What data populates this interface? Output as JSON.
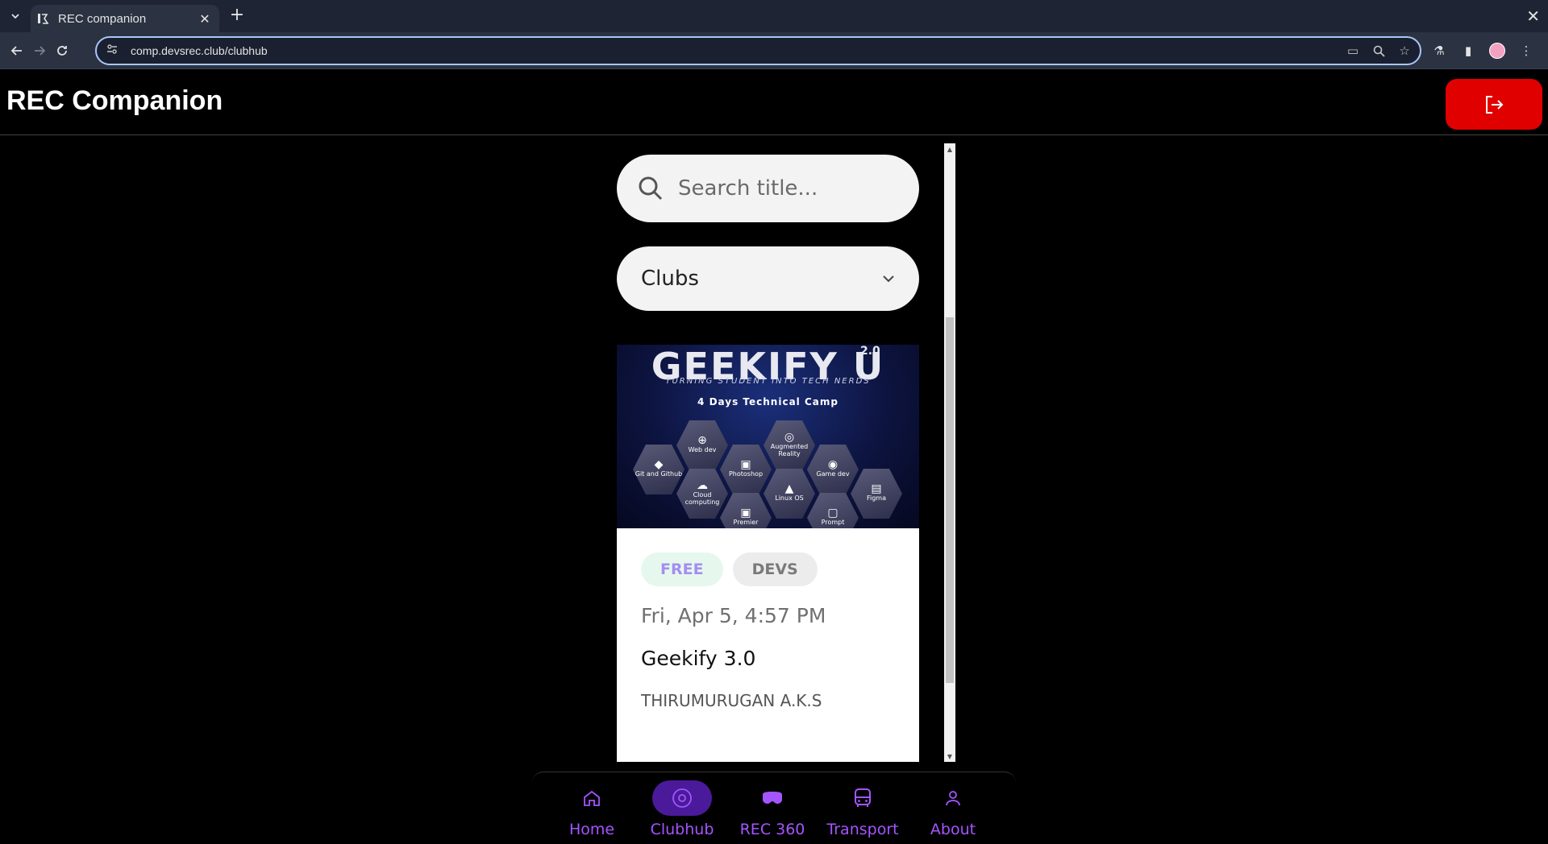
{
  "browser": {
    "tab_title": "REC companion",
    "url": "comp.devsrec.club/clubhub"
  },
  "app": {
    "title": "REC Companion",
    "logout_icon": "logout-icon",
    "accent_color": "#e10000"
  },
  "search": {
    "placeholder": "Search title..."
  },
  "filter": {
    "selected": "Clubs"
  },
  "event_card": {
    "banner": {
      "title": "GEEKIFY U",
      "superscript": "2.0",
      "subtitle": "TURNING STUDENT INTO TECH NERDS",
      "camp": "4 Days Technical Camp",
      "topics": [
        "Git and Github",
        "Web dev",
        "Cloud computing",
        "Photoshop",
        "Premier",
        "Augmented Reality",
        "Linux OS",
        "Game dev",
        "Prompt",
        "Figma"
      ]
    },
    "tags": [
      "FREE",
      "DEVS"
    ],
    "date": "Fri, Apr 5, 4:57 PM",
    "title": "Geekify 3.0",
    "organizer": "THIRUMURUGAN A.K.S"
  },
  "bottom_nav": {
    "items": [
      {
        "label": "Home",
        "icon": "home-icon"
      },
      {
        "label": "Clubhub",
        "icon": "disc-icon"
      },
      {
        "label": "REC 360",
        "icon": "vr-headset-icon"
      },
      {
        "label": "Transport",
        "icon": "bus-icon"
      },
      {
        "label": "About",
        "icon": "user-icon"
      }
    ],
    "active": "Clubhub",
    "active_color": "#4a1a9a",
    "label_color": "#a455ff"
  }
}
